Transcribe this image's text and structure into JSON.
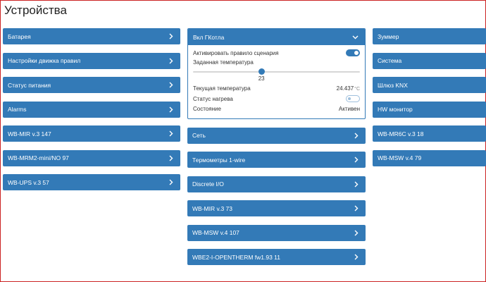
{
  "page": {
    "title": "Устройства"
  },
  "colors": {
    "accent": "#337ab7",
    "frame": "#cc2222"
  },
  "left_column": [
    {
      "label": "Батарея",
      "icon": "chevron-right-icon"
    },
    {
      "label": "Настройки движка правил",
      "icon": "chevron-right-icon"
    },
    {
      "label": "Статус питания",
      "icon": "chevron-right-icon"
    },
    {
      "label": "Alarms",
      "icon": "chevron-right-icon"
    },
    {
      "label": "WB-MIR v.3 147",
      "icon": "chevron-right-icon"
    },
    {
      "label": "WB-MRM2-mini/NO 97",
      "icon": "chevron-right-icon"
    },
    {
      "label": "WB-UPS v.3 57",
      "icon": "chevron-right-icon"
    }
  ],
  "expanded_card": {
    "label": "Вкл ГКотла",
    "icon": "chevron-down-icon",
    "activate_label": "Активировать правило сценария",
    "activate_on": true,
    "setpoint_label": "Заданная температура",
    "setpoint_value": "23",
    "setpoint_fraction": 0.41,
    "current_temp_label": "Текущая температура",
    "current_temp_value": "24.437",
    "current_temp_unit": "°C",
    "heating_label": "Статус нагрева",
    "heating_on": false,
    "state_label": "Состояние",
    "state_value": "Активен"
  },
  "middle_column": [
    {
      "label": "Сеть",
      "icon": "chevron-right-icon"
    },
    {
      "label": "Термометры 1-wire",
      "icon": "chevron-right-icon"
    },
    {
      "label": "Discrete I/O",
      "icon": "chevron-right-icon"
    },
    {
      "label": "WB-MIR v.3 73",
      "icon": "chevron-right-icon"
    },
    {
      "label": "WB-MSW v.4 107",
      "icon": "chevron-right-icon"
    },
    {
      "label": "WBE2-I-OPENTHERM fw1.93 11",
      "icon": "chevron-right-icon"
    }
  ],
  "right_column": [
    {
      "label": "Зуммер"
    },
    {
      "label": "Система"
    },
    {
      "label": "Шлюз KNX"
    },
    {
      "label": "HW монитор"
    },
    {
      "label": "WB-MR6C v.3 18"
    },
    {
      "label": "WB-MSW v.4 79"
    }
  ]
}
